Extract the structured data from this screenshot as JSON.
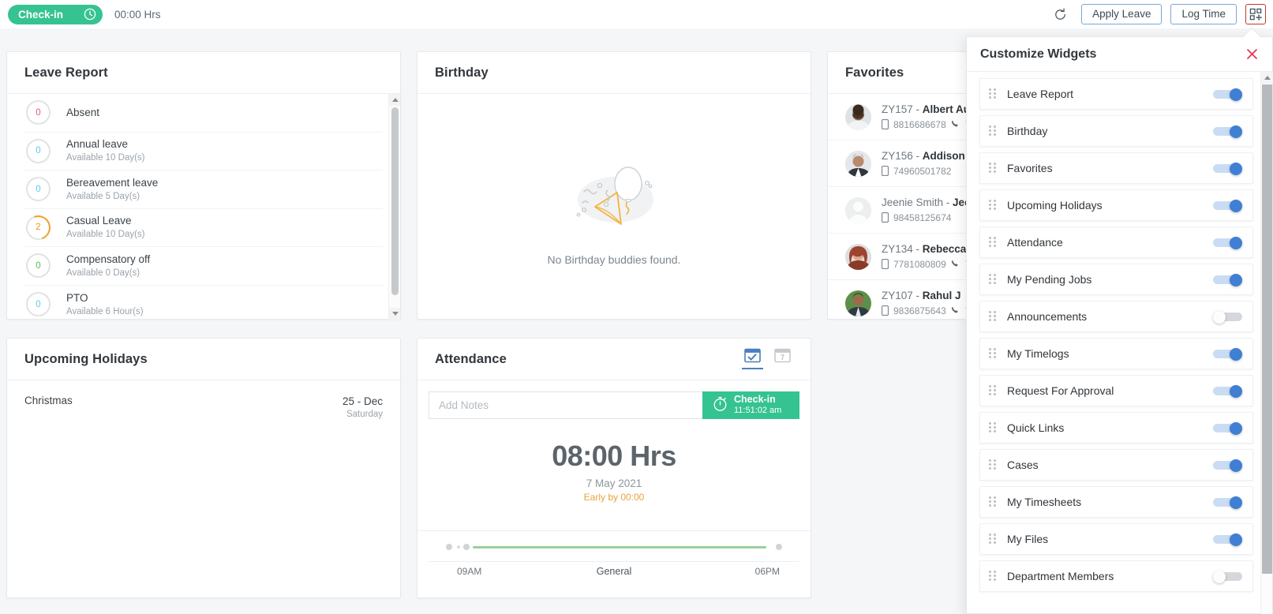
{
  "topbar": {
    "checkin_label": "Check-in",
    "hours": "00:00 Hrs",
    "apply_leave_label": "Apply Leave",
    "log_time_label": "Log Time",
    "refresh_icon": "refresh-icon",
    "customize_icon": "customize-widgets-icon",
    "customize_icon_border_color": "#c0392b",
    "checkin_pill_color": "#35c391"
  },
  "leave_report": {
    "title": "Leave Report",
    "rows": [
      {
        "count": "0",
        "count_color": "#e8566f",
        "name": "Absent",
        "sub": "",
        "arc": false
      },
      {
        "count": "0",
        "count_color": "#63c8e8",
        "name": "Annual leave",
        "sub": "Available 10 Day(s)",
        "arc": false
      },
      {
        "count": "0",
        "count_color": "#63c8e8",
        "name": "Bereavement leave",
        "sub": "Available 5 Day(s)",
        "arc": false
      },
      {
        "count": "2",
        "count_color": "#e8952a",
        "name": "Casual Leave",
        "sub": "Available 10 Day(s)",
        "arc": true
      },
      {
        "count": "0",
        "count_color": "#4fc24f",
        "name": "Compensatory off",
        "sub": "Available 0 Day(s)",
        "arc": false
      },
      {
        "count": "0",
        "count_color": "#63c8e8",
        "name": "PTO",
        "sub": "Available 6 Hour(s)",
        "arc": false
      }
    ]
  },
  "upcoming_holidays": {
    "title": "Upcoming Holidays",
    "rows": [
      {
        "name": "Christmas",
        "date": "25 - Dec",
        "day": "Saturday"
      }
    ]
  },
  "birthday": {
    "title": "Birthday",
    "empty_text": "No Birthday buddies found.",
    "empty_illustration": "balloon-and-party-popper-illustration"
  },
  "attendance": {
    "title": "Attendance",
    "tabs": [
      {
        "icon": "calendar-check-icon",
        "active": true
      },
      {
        "icon": "calendar-date-icon",
        "active": false
      }
    ],
    "notes_placeholder": "Add Notes",
    "notes_value": "",
    "checkin_button_label": "Check-in",
    "checkin_button_time": "11:51:02 am",
    "checkin_button_color": "#35c391",
    "hours": "08:00 Hrs",
    "date": "7 May 2021",
    "early_text": "Early by 00:00",
    "early_color": "#e8a33d",
    "timeline": {
      "start_label": "09AM",
      "shift_label": "General",
      "end_label": "06PM",
      "bar_color": "#9bcf9b"
    }
  },
  "favorites": {
    "title": "Favorites",
    "rows": [
      {
        "prefix": "ZY157 - ",
        "name": "Albert Au",
        "mobile": "8816686678",
        "phone": "7",
        "avatar": "avatar-male-beard"
      },
      {
        "prefix": "ZY156 - ",
        "name": "Addison B",
        "mobile": "74960501782",
        "phone": "",
        "avatar": "avatar-male-suit"
      },
      {
        "prefix": "Jeenie Smith - ",
        "name": "Jeen",
        "mobile": "98458125674",
        "phone": "",
        "avatar": "avatar-placeholder"
      },
      {
        "prefix": "ZY134 - ",
        "name": "Rebecca E",
        "mobile": "7781080809",
        "phone": "7",
        "avatar": "avatar-female-red-hair"
      },
      {
        "prefix": "ZY107 - ",
        "name": "Rahul J",
        "mobile": "9836875643",
        "phone": "7",
        "avatar": "avatar-male-green-bg"
      }
    ]
  },
  "customize_widgets": {
    "title": "Customize Widgets",
    "close_icon": "close-icon",
    "close_icon_color": "#e0354e",
    "items": [
      {
        "label": "Leave Report",
        "enabled": true
      },
      {
        "label": "Birthday",
        "enabled": true
      },
      {
        "label": "Favorites",
        "enabled": true
      },
      {
        "label": "Upcoming Holidays",
        "enabled": true
      },
      {
        "label": "Attendance",
        "enabled": true
      },
      {
        "label": "My Pending Jobs",
        "enabled": true
      },
      {
        "label": "Announcements",
        "enabled": false
      },
      {
        "label": "My Timelogs",
        "enabled": true
      },
      {
        "label": "Request For Approval",
        "enabled": true
      },
      {
        "label": "Quick Links",
        "enabled": true
      },
      {
        "label": "Cases",
        "enabled": true
      },
      {
        "label": "My Timesheets",
        "enabled": true
      },
      {
        "label": "My Files",
        "enabled": true
      },
      {
        "label": "Department Members",
        "enabled": false
      }
    ],
    "toggle_on_color": "#3f7fd4",
    "toggle_off_color": "#d4d8dc"
  }
}
